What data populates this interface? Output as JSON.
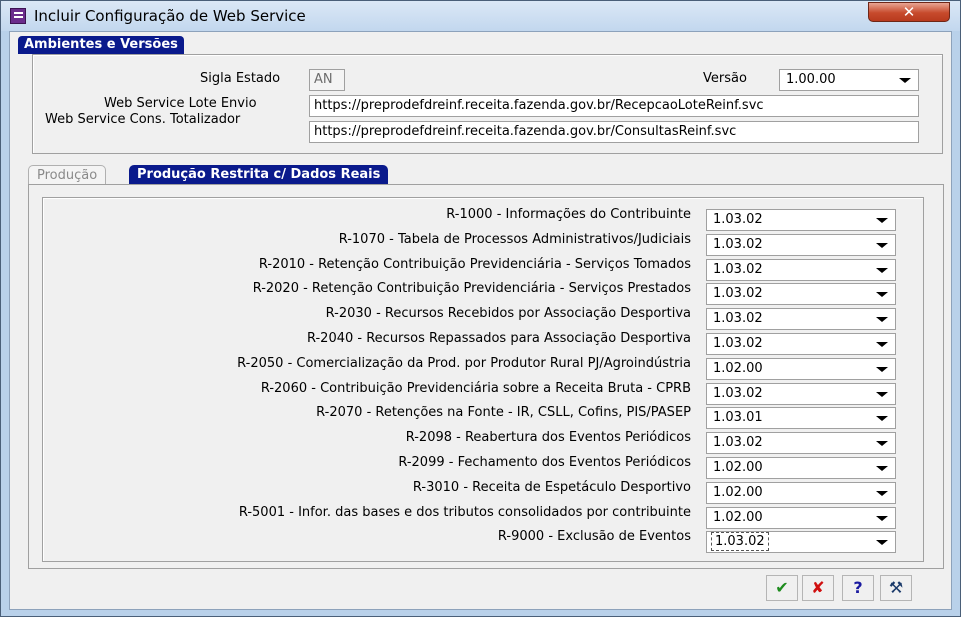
{
  "window": {
    "title": "Incluir Configuração de Web Service",
    "close_label": "✕"
  },
  "section": {
    "title": "Ambientes e Versões"
  },
  "top": {
    "sigla_label": "Sigla Estado",
    "sigla_value": "AN",
    "versao_label": "Versão",
    "versao_value": "1.00.00",
    "lote_label": "Web Service Lote Envio",
    "lote_value": "https://preprodefdreinf.receita.fazenda.gov.br/RecepcaoLoteReinf.svc",
    "cons_label": "Web Service Cons. Totalizador",
    "cons_value": "https://preprodefdreinf.receita.fazenda.gov.br/ConsultasReinf.svc"
  },
  "tabs": [
    {
      "label": "Produção",
      "active": false
    },
    {
      "label": "Produção Restrita c/ Dados Reais",
      "active": true
    }
  ],
  "events": [
    {
      "label": "R-1000 - Informações do Contribuinte",
      "version": "1.03.02"
    },
    {
      "label": "R-1070 - Tabela de Processos Administrativos/Judiciais",
      "version": "1.03.02"
    },
    {
      "label": "R-2010 - Retenção Contribuição Previdenciária - Serviços Tomados",
      "version": "1.03.02"
    },
    {
      "label": "R-2020 - Retenção Contribuição Previdenciária - Serviços Prestados",
      "version": "1.03.02"
    },
    {
      "label": "R-2030 - Recursos Recebidos por Associação Desportiva",
      "version": "1.03.02"
    },
    {
      "label": "R-2040 - Recursos Repassados para Associação Desportiva",
      "version": "1.03.02"
    },
    {
      "label": "R-2050 - Comercialização da Prod. por Produtor Rural PJ/Agroindústria",
      "version": "1.02.00"
    },
    {
      "label": "R-2060 - Contribuição Previdenciária sobre a Receita Bruta - CPRB",
      "version": "1.03.02"
    },
    {
      "label": "R-2070 - Retenções na Fonte - IR, CSLL, Cofins, PIS/PASEP",
      "version": "1.03.01"
    },
    {
      "label": "R-2098 - Reabertura dos Eventos Periódicos",
      "version": "1.03.02"
    },
    {
      "label": "R-2099 - Fechamento dos Eventos Periódicos",
      "version": "1.02.00"
    },
    {
      "label": "R-3010 - Receita de Espetáculo Desportivo",
      "version": "1.02.00"
    },
    {
      "label": "R-5001 - Infor. das bases e dos tributos consolidados por contribuinte",
      "version": "1.02.00"
    },
    {
      "label": "R-9000 - Exclusão de Eventos",
      "version": "1.03.02"
    }
  ],
  "buttons": {
    "ok_icon": "check-icon",
    "cancel_icon": "x-icon",
    "help_icon": "question-icon",
    "extra_icon": "tool-icon",
    "ok_glyph": "✔",
    "cancel_glyph": "✘",
    "help_glyph": "?",
    "extra_glyph": "⚒"
  },
  "colors": {
    "tab_active": "#0a1a8c",
    "ok": "#1e8c1e",
    "cancel": "#d01010",
    "help": "#1a1aa0"
  }
}
